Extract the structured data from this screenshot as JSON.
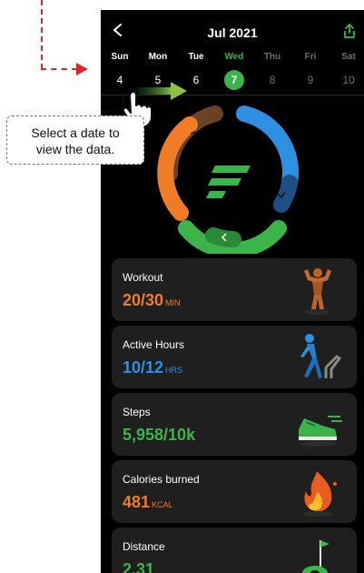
{
  "header": {
    "month": "Jul 2021",
    "back_icon": "chevron-left-icon",
    "share_icon": "share-icon"
  },
  "week": [
    {
      "name": "Sun",
      "num": "4",
      "state": "past"
    },
    {
      "name": "Mon",
      "num": "5",
      "state": "past"
    },
    {
      "name": "Tue",
      "num": "6",
      "state": "past"
    },
    {
      "name": "Wed",
      "num": "7",
      "state": "selected"
    },
    {
      "name": "Thu",
      "num": "8",
      "state": "future"
    },
    {
      "name": "Fri",
      "num": "9",
      "state": "future"
    },
    {
      "name": "Sat",
      "num": "10",
      "state": "future"
    }
  ],
  "cards": [
    {
      "title": "Workout",
      "value": "20/30",
      "unit": "MIN",
      "color": "#f07c28",
      "icon": "flexing-figure-icon"
    },
    {
      "title": "Active Hours",
      "value": "10/12",
      "unit": "HRS",
      "color": "#2f8fe0",
      "icon": "walking-person-icon"
    },
    {
      "title": "Steps",
      "value": "5,958/10k",
      "unit": "",
      "color": "#3bb54a",
      "icon": "sneaker-icon"
    },
    {
      "title": "Calories burned",
      "value": "481",
      "unit": "KCAL",
      "color": "#f07c28",
      "icon": "flame-icon"
    },
    {
      "title": "Distance",
      "value": "2.31",
      "unit": "",
      "color": "#3bb54a",
      "icon": "golf-flag-icon"
    }
  ],
  "annotation": {
    "line1": "Select a date to",
    "line2": "view the data."
  },
  "colors": {
    "accent_green": "#3bb54a",
    "orange": "#f07c28",
    "blue": "#2f8fe0",
    "brown": "#7a4a2a",
    "guide_red": "#e0242a"
  }
}
